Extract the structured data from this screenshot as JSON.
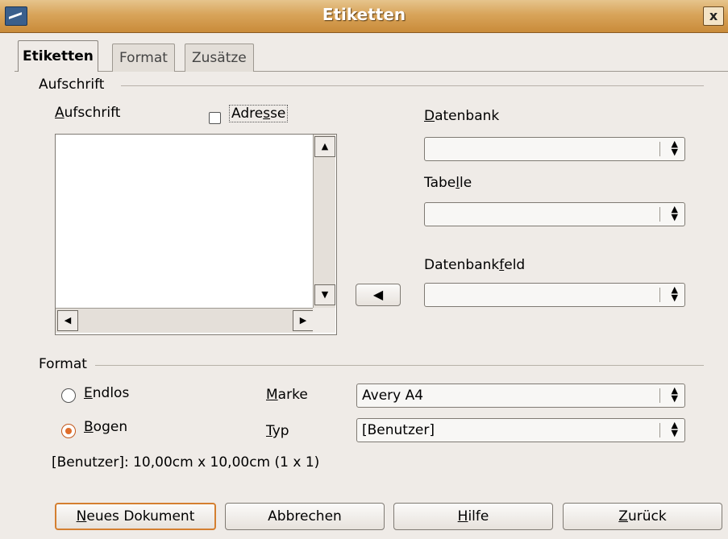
{
  "window": {
    "title": "Etiketten",
    "close_label": "x"
  },
  "tabs": [
    {
      "label": "Etiketten",
      "active": true
    },
    {
      "label": "Format",
      "active": false
    },
    {
      "label": "Zusätze",
      "active": false
    }
  ],
  "aufschrift_section": {
    "heading": "Aufschrift",
    "field_label": "Aufschrift",
    "field_label_accel": "A",
    "field_label_rest": "ufschrift",
    "field_value": "",
    "address_checkbox": {
      "label_before": "Adre",
      "label_accel": "s",
      "label_after": "se",
      "checked": false
    }
  },
  "database": {
    "datenbank": {
      "label_accel": "D",
      "label_rest": "atenbank",
      "value": ""
    },
    "tabelle": {
      "label_before": "Tabe",
      "label_accel": "l",
      "label_after": "le",
      "value": ""
    },
    "datenbankfeld": {
      "label_before": "Datenbank",
      "label_accel": "f",
      "label_after": "eld",
      "value": ""
    },
    "insert_arrow_icon": "arrow-left-icon"
  },
  "format_section": {
    "heading": "Format",
    "endlos": {
      "label_accel": "E",
      "label_rest": "ndlos",
      "selected": false
    },
    "bogen": {
      "label_accel": "B",
      "label_rest": "ogen",
      "selected": true
    },
    "marke": {
      "label_accel": "M",
      "label_rest": "arke",
      "value": "Avery A4"
    },
    "typ": {
      "label_accel": "T",
      "label_rest": "yp",
      "value": "[Benutzer]"
    },
    "info": "[Benutzer]: 10,00cm x 10,00cm (1 x 1)"
  },
  "buttons": {
    "neues_dokument": {
      "accel": "N",
      "rest": "eues Dokument"
    },
    "abbrechen": "Abbrechen",
    "hilfe": {
      "accel": "H",
      "rest": "ilfe"
    },
    "zurueck": {
      "accel": "Z",
      "rest": "urück"
    }
  },
  "colors": {
    "titlebar": "#d8a45a",
    "accent": "#e06d2a",
    "background": "#efebe7"
  }
}
